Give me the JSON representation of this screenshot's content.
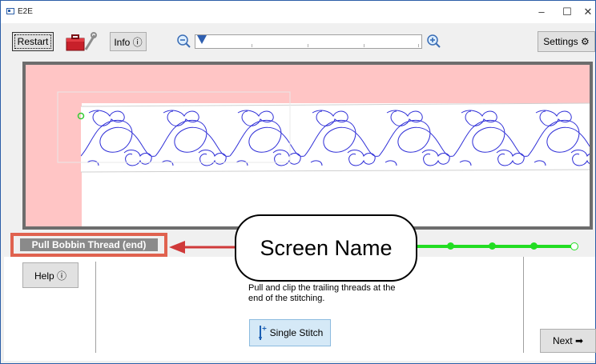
{
  "window": {
    "title": "E2E",
    "minimize": "–",
    "maximize": "☐",
    "close": "✕"
  },
  "toolbar": {
    "restart_label": "Restart",
    "info_label": "Info ⓘ",
    "settings_label": "Settings ⚙"
  },
  "status": {
    "screen_name": "Pull Bobbin Thread (end)"
  },
  "callout": {
    "text": "Screen Name"
  },
  "progress": {
    "fraction": 1.0,
    "steps_completed": 4
  },
  "panel": {
    "help_label": "Help ⓘ",
    "instructions": "Pull and clip the trailing threads at the end of the stitching.",
    "single_stitch_label": "Single Stitch",
    "next_label": "Next ➡"
  },
  "colors": {
    "highlight": "#e0624f",
    "progress": "#22dd22",
    "pattern": "#2f2fd8",
    "margin": "#ffc5c5"
  }
}
